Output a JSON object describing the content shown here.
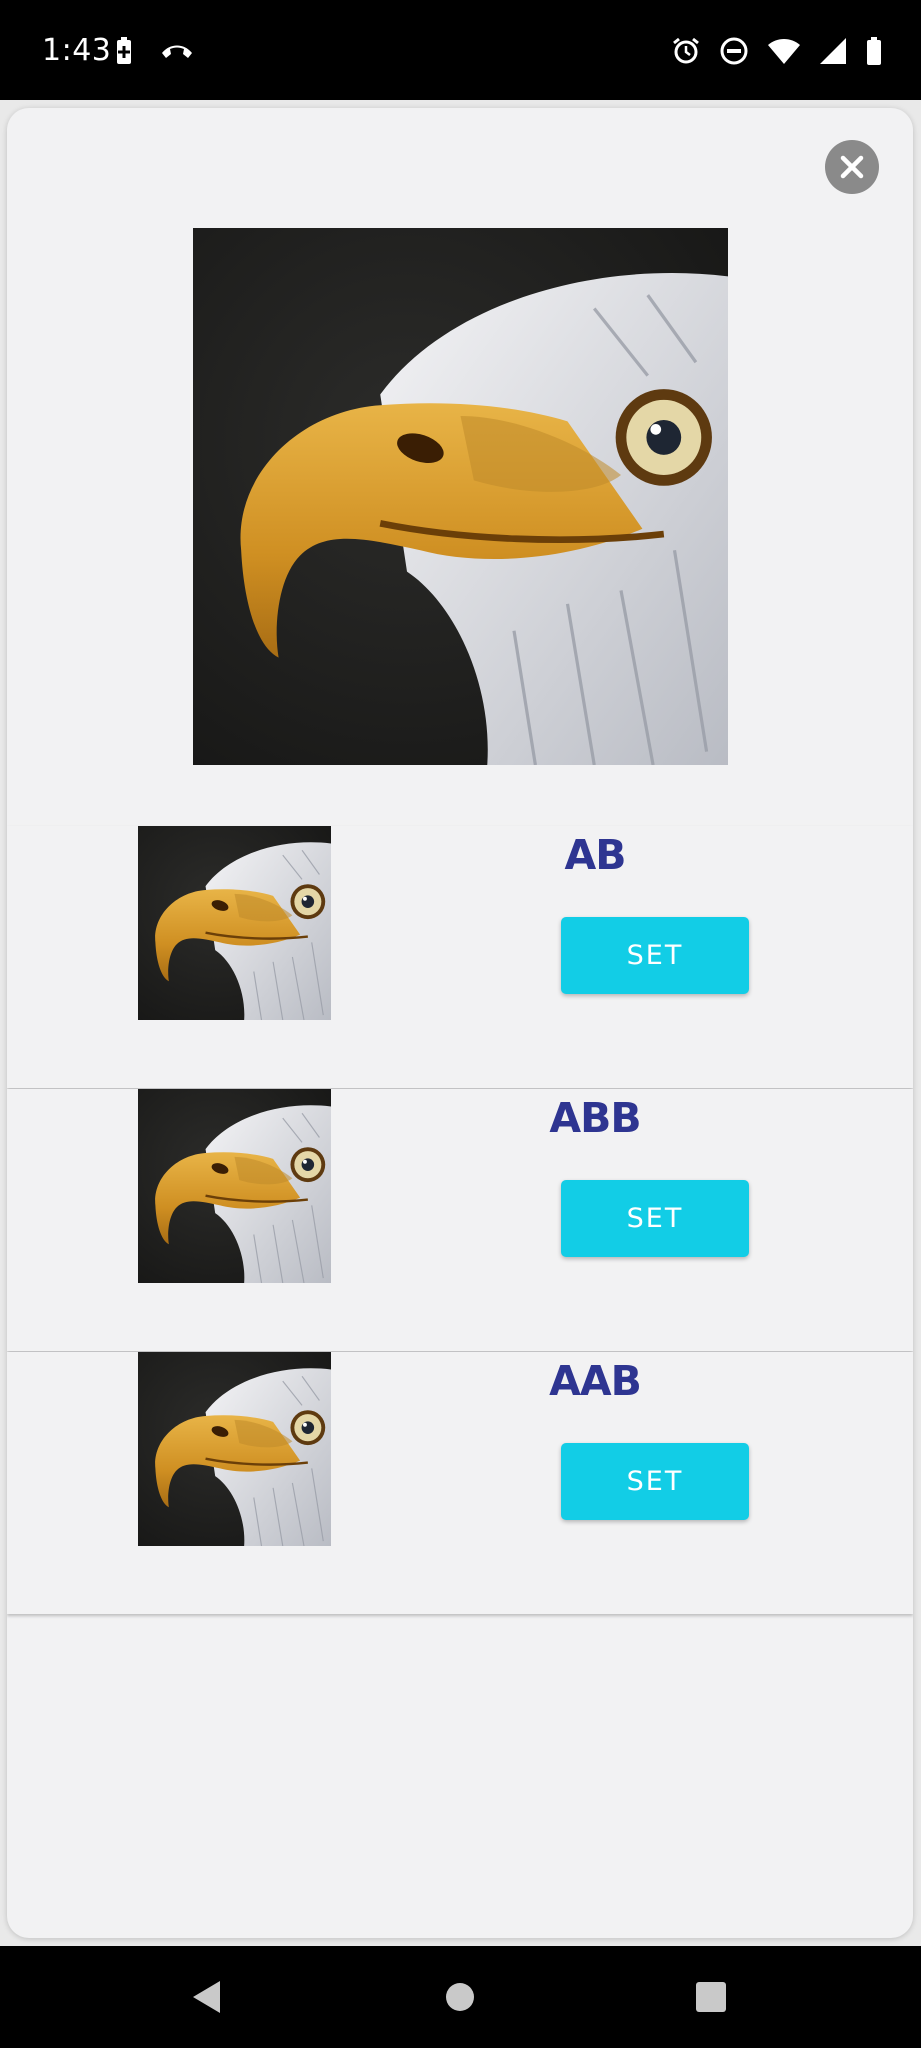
{
  "status_bar": {
    "time": "1:43",
    "left_icons": [
      "battery-saver-icon",
      "missed-call-icon"
    ],
    "right_icons": [
      "alarm-icon",
      "do-not-disturb-icon",
      "wifi-icon",
      "signal-icon",
      "battery-icon"
    ]
  },
  "modal": {
    "close_icon": "close-icon",
    "hero_image": "bald-eagle-head-photo",
    "options": [
      {
        "label": "AB",
        "button": "SET",
        "thumbnail": "bald-eagle-head-photo"
      },
      {
        "label": "ABB",
        "button": "SET",
        "thumbnail": "bald-eagle-head-photo"
      },
      {
        "label": "AAB",
        "button": "SET",
        "thumbnail": "bald-eagle-head-photo"
      }
    ]
  },
  "nav_bar": {
    "icons": [
      "back-icon",
      "home-icon",
      "recents-icon"
    ]
  },
  "colors": {
    "label": "#2e3591",
    "button": "#12cde6",
    "modal_bg": "#f2f2f3",
    "close_button": "#8a8a8a"
  }
}
